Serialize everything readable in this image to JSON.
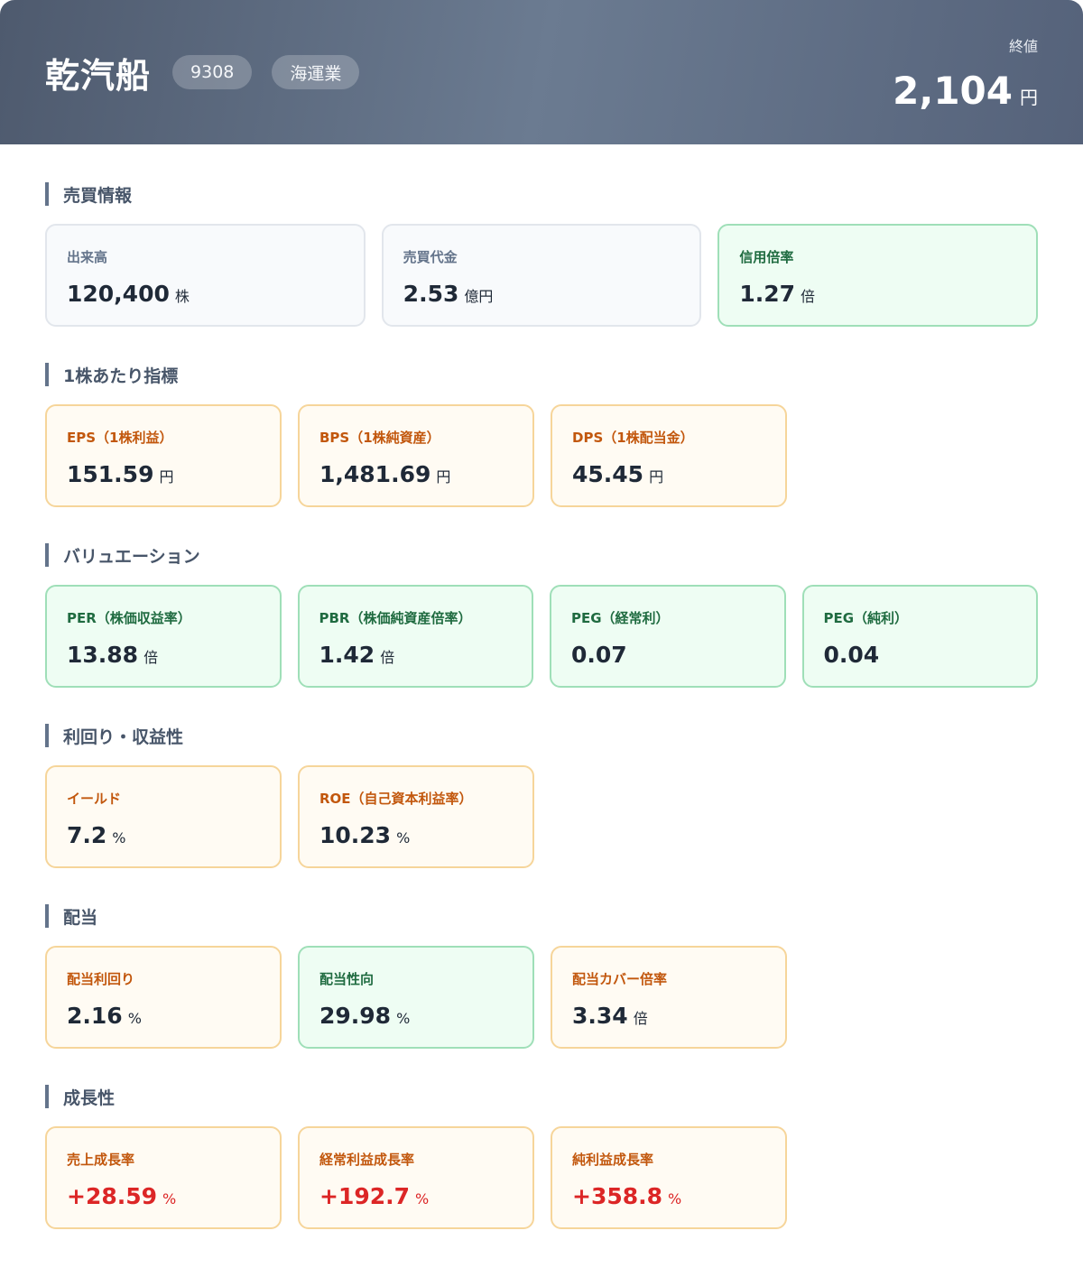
{
  "header": {
    "company": "乾汽船",
    "code": "9308",
    "industry": "海運業",
    "price_label": "終値",
    "price": "2,104",
    "price_unit": "円"
  },
  "sections": {
    "trading": {
      "title": "売買情報",
      "cards": [
        {
          "label": "出来高",
          "value": "120,400",
          "unit": "株"
        },
        {
          "label": "売買代金",
          "value": "2.53",
          "unit": "億円"
        },
        {
          "label": "信用倍率",
          "value": "1.27",
          "unit": "倍"
        }
      ]
    },
    "per_share": {
      "title": "1株あたり指標",
      "cards": [
        {
          "label": "EPS（1株利益）",
          "value": "151.59",
          "unit": "円"
        },
        {
          "label": "BPS（1株純資産）",
          "value": "1,481.69",
          "unit": "円"
        },
        {
          "label": "DPS（1株配当金）",
          "value": "45.45",
          "unit": "円"
        }
      ]
    },
    "valuation": {
      "title": "バリュエーション",
      "cards": [
        {
          "label": "PER（株価収益率）",
          "value": "13.88",
          "unit": "倍"
        },
        {
          "label": "PBR（株価純資産倍率）",
          "value": "1.42",
          "unit": "倍"
        },
        {
          "label": "PEG（経常利）",
          "value": "0.07",
          "unit": ""
        },
        {
          "label": "PEG（純利）",
          "value": "0.04",
          "unit": ""
        }
      ]
    },
    "yield": {
      "title": "利回り・収益性",
      "cards": [
        {
          "label": "イールド",
          "value": "7.2",
          "unit": "%"
        },
        {
          "label": "ROE（自己資本利益率）",
          "value": "10.23",
          "unit": "%"
        }
      ]
    },
    "dividend": {
      "title": "配当",
      "cards": [
        {
          "label": "配当利回り",
          "value": "2.16",
          "unit": "%"
        },
        {
          "label": "配当性向",
          "value": "29.98",
          "unit": "%"
        },
        {
          "label": "配当カバー倍率",
          "value": "3.34",
          "unit": "倍"
        }
      ]
    },
    "growth": {
      "title": "成長性",
      "cards": [
        {
          "label": "売上成長率",
          "value": "+28.59",
          "unit": "%"
        },
        {
          "label": "経常利益成長率",
          "value": "+192.7",
          "unit": "%"
        },
        {
          "label": "純利益成長率",
          "value": "+358.8",
          "unit": "%"
        }
      ]
    }
  },
  "colors": {
    "green_bg": "#eefdf3",
    "orange_bg": "#fffbf3",
    "positive_text": "#dc2626"
  }
}
